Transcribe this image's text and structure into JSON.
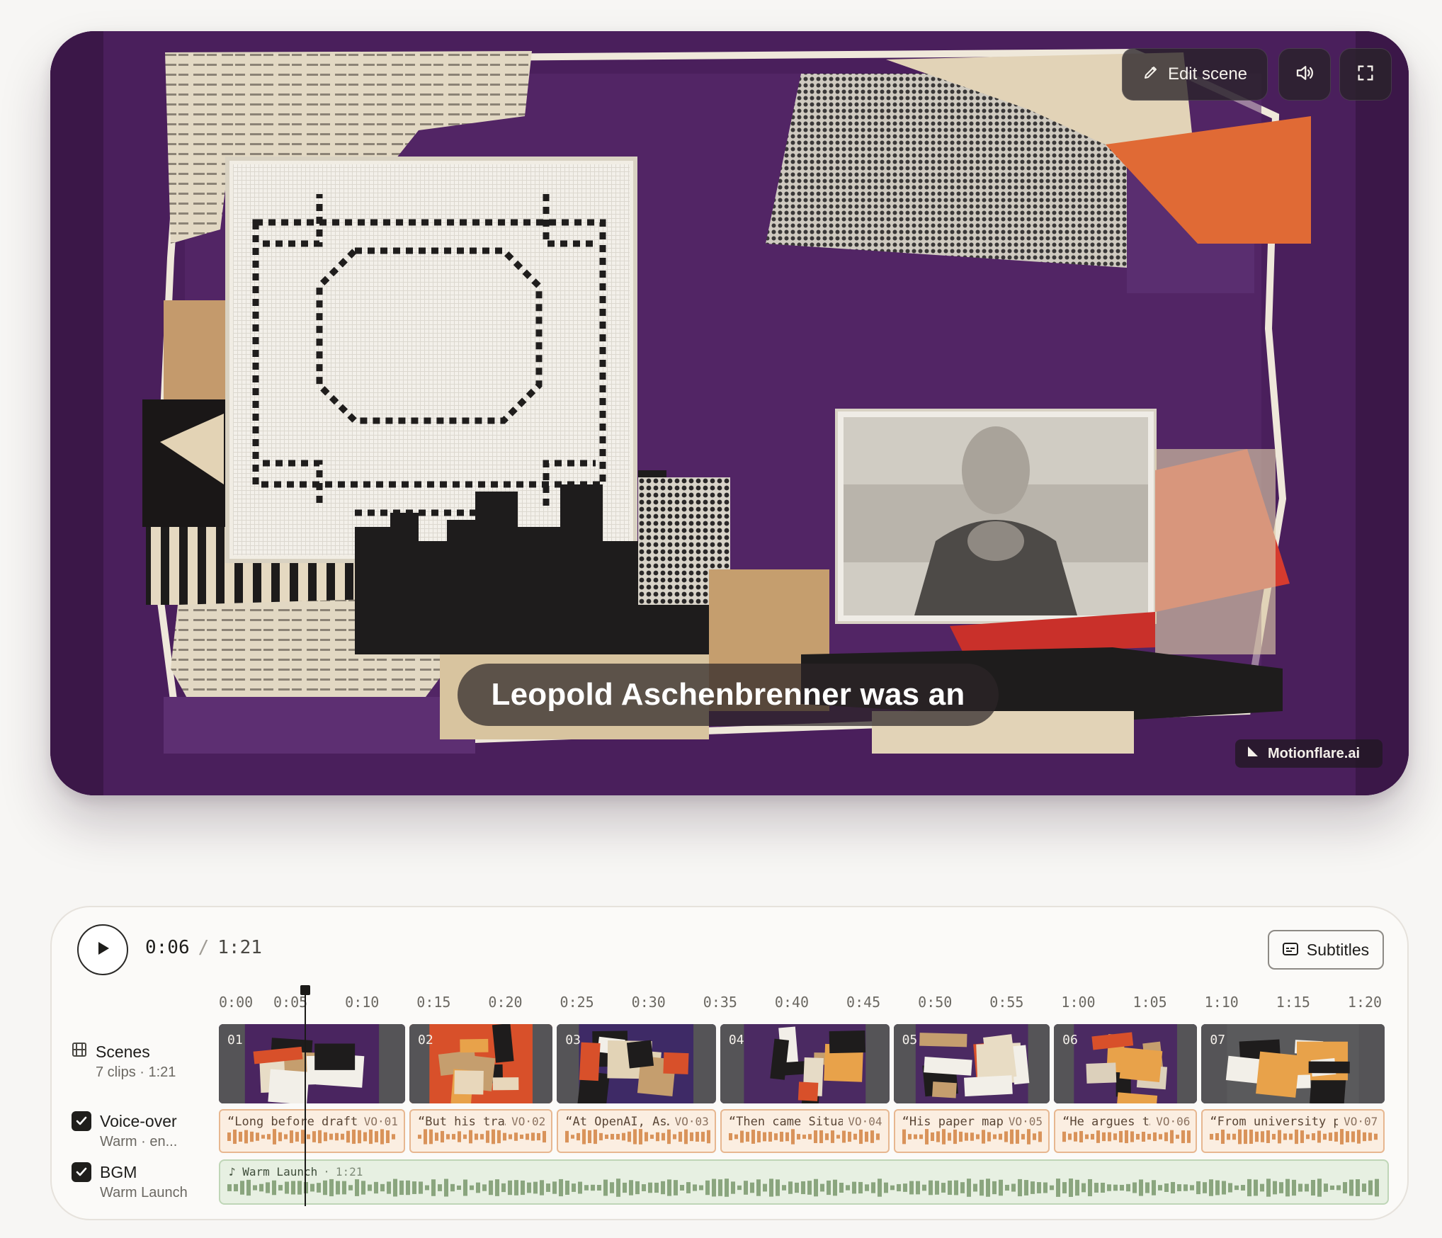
{
  "player": {
    "edit_scene_label": "Edit scene",
    "subtitle_text": "Leopold Aschenbrenner was an",
    "watermark": "Motionflare.ai",
    "icons": {
      "edit": "pencil-icon",
      "audio": "speaker-icon",
      "fullscreen": "fullscreen-icon"
    }
  },
  "controls": {
    "current_time": "0:06",
    "separator": "/",
    "duration": "1:21",
    "subtitles_label": "Subtitles",
    "playhead_seconds": 6,
    "total_seconds": 81
  },
  "ruler": {
    "ticks": [
      "0:00",
      "0:05",
      "0:10",
      "0:15",
      "0:20",
      "0:25",
      "0:30",
      "0:35",
      "0:40",
      "0:45",
      "0:50",
      "0:55",
      "1:00",
      "1:05",
      "1:10",
      "1:15",
      "1:20"
    ]
  },
  "tracks": {
    "scenes": {
      "label": "Scenes",
      "sub": "7 clips · 1:21"
    },
    "voiceover": {
      "label": "Voice-over",
      "sub": "Warm · en..."
    },
    "bgm": {
      "label": "BGM",
      "sub": "Warm Launch",
      "clip_name": "♪ Warm Launch",
      "clip_sep": "·",
      "clip_duration": "1:21"
    }
  },
  "scenes": [
    {
      "num": "01",
      "start": 0,
      "end": 13,
      "bg": "#4a2560",
      "accent": "#e7dcc6"
    },
    {
      "num": "02",
      "start": 13.3,
      "end": 23.3,
      "bg": "#d8502a",
      "accent": "#e8d7bb"
    },
    {
      "num": "03",
      "start": 23.6,
      "end": 34.7,
      "bg": "#3e2a66",
      "accent": "#e2d3b6"
    },
    {
      "num": "04",
      "start": 35,
      "end": 46.8,
      "bg": "#4b2a62",
      "accent": "#e6dbc6"
    },
    {
      "num": "05",
      "start": 47.1,
      "end": 58,
      "bg": "#4b2a62",
      "accent": "#e8dcc4"
    },
    {
      "num": "06",
      "start": 58.3,
      "end": 68.3,
      "bg": "#4b2a62",
      "accent": "#dcd0bb"
    },
    {
      "num": "07",
      "start": 68.6,
      "end": 81.4,
      "bg": "#5a5a5c",
      "accent": "#e8dcc6"
    }
  ],
  "voiceover_clips": [
    {
      "text": "“Long before draft…",
      "id": "VO·01"
    },
    {
      "text": "“But his tra…",
      "id": "VO·02"
    },
    {
      "text": "“At OpenAI, As…",
      "id": "VO·03"
    },
    {
      "text": "“Then came Situa…",
      "id": "VO·04"
    },
    {
      "text": "“His paper map…",
      "id": "VO·05"
    },
    {
      "text": "“He argues t…",
      "id": "VO·06"
    },
    {
      "text": "“From university p…",
      "id": "VO·07"
    }
  ],
  "colors": {
    "player_bg": "#4a1f5c",
    "vo_border": "#e7b790",
    "vo_wave": "#d9935a",
    "bgm_bg": "#e7f0e2",
    "bgm_wave": "#8aa57e"
  }
}
